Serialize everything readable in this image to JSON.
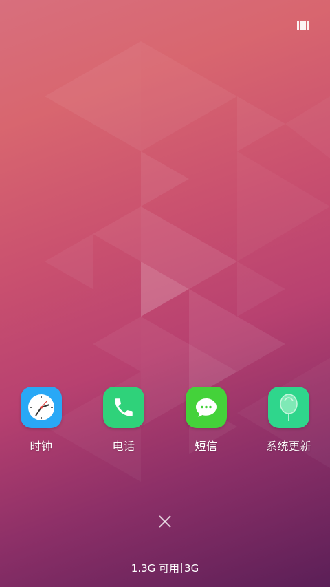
{
  "apps": [
    {
      "label": "时钟",
      "icon": "clock-icon",
      "color": "#29a8f6"
    },
    {
      "label": "电话",
      "icon": "phone-icon",
      "color": "#2fd27a"
    },
    {
      "label": "短信",
      "icon": "message-icon",
      "color": "#44d23a"
    },
    {
      "label": "系统更新",
      "icon": "balloon-icon",
      "color": "#2fd68c"
    }
  ],
  "memory": {
    "available": "1.3G 可用",
    "total": "3G"
  },
  "controls": {
    "recent_icon": "recents-icon",
    "clear_icon": "close-icon"
  }
}
